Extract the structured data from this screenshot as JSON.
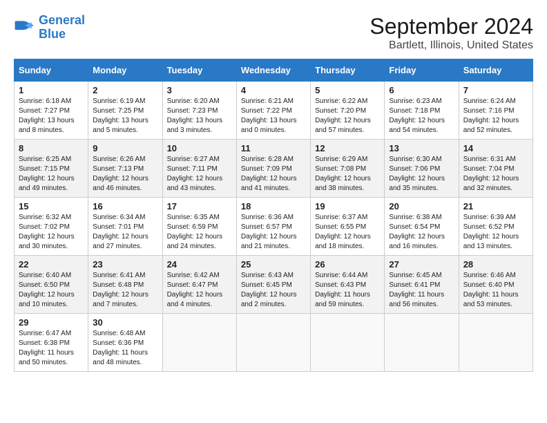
{
  "logo": {
    "line1": "General",
    "line2": "Blue"
  },
  "title": "September 2024",
  "subtitle": "Bartlett, Illinois, United States",
  "days_of_week": [
    "Sunday",
    "Monday",
    "Tuesday",
    "Wednesday",
    "Thursday",
    "Friday",
    "Saturday"
  ],
  "weeks": [
    [
      {
        "day": "1",
        "info": "Sunrise: 6:18 AM\nSunset: 7:27 PM\nDaylight: 13 hours\nand 8 minutes."
      },
      {
        "day": "2",
        "info": "Sunrise: 6:19 AM\nSunset: 7:25 PM\nDaylight: 13 hours\nand 5 minutes."
      },
      {
        "day": "3",
        "info": "Sunrise: 6:20 AM\nSunset: 7:23 PM\nDaylight: 13 hours\nand 3 minutes."
      },
      {
        "day": "4",
        "info": "Sunrise: 6:21 AM\nSunset: 7:22 PM\nDaylight: 13 hours\nand 0 minutes."
      },
      {
        "day": "5",
        "info": "Sunrise: 6:22 AM\nSunset: 7:20 PM\nDaylight: 12 hours\nand 57 minutes."
      },
      {
        "day": "6",
        "info": "Sunrise: 6:23 AM\nSunset: 7:18 PM\nDaylight: 12 hours\nand 54 minutes."
      },
      {
        "day": "7",
        "info": "Sunrise: 6:24 AM\nSunset: 7:16 PM\nDaylight: 12 hours\nand 52 minutes."
      }
    ],
    [
      {
        "day": "8",
        "info": "Sunrise: 6:25 AM\nSunset: 7:15 PM\nDaylight: 12 hours\nand 49 minutes."
      },
      {
        "day": "9",
        "info": "Sunrise: 6:26 AM\nSunset: 7:13 PM\nDaylight: 12 hours\nand 46 minutes."
      },
      {
        "day": "10",
        "info": "Sunrise: 6:27 AM\nSunset: 7:11 PM\nDaylight: 12 hours\nand 43 minutes."
      },
      {
        "day": "11",
        "info": "Sunrise: 6:28 AM\nSunset: 7:09 PM\nDaylight: 12 hours\nand 41 minutes."
      },
      {
        "day": "12",
        "info": "Sunrise: 6:29 AM\nSunset: 7:08 PM\nDaylight: 12 hours\nand 38 minutes."
      },
      {
        "day": "13",
        "info": "Sunrise: 6:30 AM\nSunset: 7:06 PM\nDaylight: 12 hours\nand 35 minutes."
      },
      {
        "day": "14",
        "info": "Sunrise: 6:31 AM\nSunset: 7:04 PM\nDaylight: 12 hours\nand 32 minutes."
      }
    ],
    [
      {
        "day": "15",
        "info": "Sunrise: 6:32 AM\nSunset: 7:02 PM\nDaylight: 12 hours\nand 30 minutes."
      },
      {
        "day": "16",
        "info": "Sunrise: 6:34 AM\nSunset: 7:01 PM\nDaylight: 12 hours\nand 27 minutes."
      },
      {
        "day": "17",
        "info": "Sunrise: 6:35 AM\nSunset: 6:59 PM\nDaylight: 12 hours\nand 24 minutes."
      },
      {
        "day": "18",
        "info": "Sunrise: 6:36 AM\nSunset: 6:57 PM\nDaylight: 12 hours\nand 21 minutes."
      },
      {
        "day": "19",
        "info": "Sunrise: 6:37 AM\nSunset: 6:55 PM\nDaylight: 12 hours\nand 18 minutes."
      },
      {
        "day": "20",
        "info": "Sunrise: 6:38 AM\nSunset: 6:54 PM\nDaylight: 12 hours\nand 16 minutes."
      },
      {
        "day": "21",
        "info": "Sunrise: 6:39 AM\nSunset: 6:52 PM\nDaylight: 12 hours\nand 13 minutes."
      }
    ],
    [
      {
        "day": "22",
        "info": "Sunrise: 6:40 AM\nSunset: 6:50 PM\nDaylight: 12 hours\nand 10 minutes."
      },
      {
        "day": "23",
        "info": "Sunrise: 6:41 AM\nSunset: 6:48 PM\nDaylight: 12 hours\nand 7 minutes."
      },
      {
        "day": "24",
        "info": "Sunrise: 6:42 AM\nSunset: 6:47 PM\nDaylight: 12 hours\nand 4 minutes."
      },
      {
        "day": "25",
        "info": "Sunrise: 6:43 AM\nSunset: 6:45 PM\nDaylight: 12 hours\nand 2 minutes."
      },
      {
        "day": "26",
        "info": "Sunrise: 6:44 AM\nSunset: 6:43 PM\nDaylight: 11 hours\nand 59 minutes."
      },
      {
        "day": "27",
        "info": "Sunrise: 6:45 AM\nSunset: 6:41 PM\nDaylight: 11 hours\nand 56 minutes."
      },
      {
        "day": "28",
        "info": "Sunrise: 6:46 AM\nSunset: 6:40 PM\nDaylight: 11 hours\nand 53 minutes."
      }
    ],
    [
      {
        "day": "29",
        "info": "Sunrise: 6:47 AM\nSunset: 6:38 PM\nDaylight: 11 hours\nand 50 minutes."
      },
      {
        "day": "30",
        "info": "Sunrise: 6:48 AM\nSunset: 6:36 PM\nDaylight: 11 hours\nand 48 minutes."
      },
      {
        "day": "",
        "info": ""
      },
      {
        "day": "",
        "info": ""
      },
      {
        "day": "",
        "info": ""
      },
      {
        "day": "",
        "info": ""
      },
      {
        "day": "",
        "info": ""
      }
    ]
  ]
}
